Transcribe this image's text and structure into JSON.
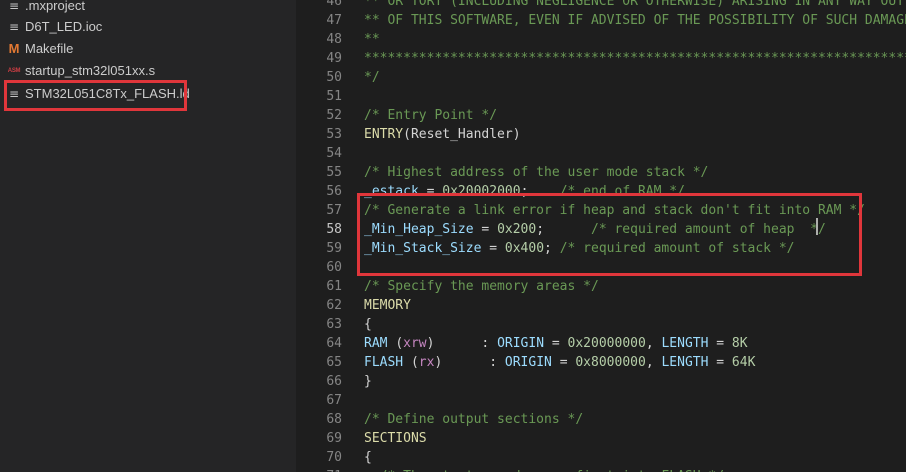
{
  "explorer": {
    "files": [
      {
        "name": ".mxproject",
        "icon": "lines-file-icon"
      },
      {
        "name": "D6T_LED.ioc",
        "icon": "lines-file-icon"
      },
      {
        "name": "Makefile",
        "icon": "makefile-icon"
      },
      {
        "name": "startup_stm32l051xx.s",
        "icon": "asm-file-icon"
      },
      {
        "name": "STM32L051C8Tx_FLASH.ld",
        "icon": "lines-file-icon"
      }
    ],
    "highlighted_file": "STM32L051C8Tx_FLASH.ld",
    "icon_glyphs": {
      "lines": "≡",
      "makefile": "M",
      "asm": "ASM"
    }
  },
  "editor": {
    "active_line": "58",
    "lines": [
      {
        "num": "46",
        "tokens": [
          {
            "t": "** OR TORT (INCLUDING NEGLIGENCE OR OTHERWISE) ARISING IN ANY WAY OUT OF THE USE",
            "c": "comment"
          }
        ]
      },
      {
        "num": "47",
        "tokens": [
          {
            "t": "** OF THIS SOFTWARE, EVEN IF ADVISED OF THE POSSIBILITY OF SUCH DAMAGE.",
            "c": "comment"
          }
        ]
      },
      {
        "num": "48",
        "tokens": [
          {
            "t": "**",
            "c": "comment"
          }
        ]
      },
      {
        "num": "49",
        "tokens": [
          {
            "t": "*****************************************************************************",
            "c": "comment"
          }
        ]
      },
      {
        "num": "50",
        "tokens": [
          {
            "t": "*/",
            "c": "comment"
          }
        ]
      },
      {
        "num": "51",
        "tokens": []
      },
      {
        "num": "52",
        "tokens": [
          {
            "t": "/* Entry Point */",
            "c": "comment"
          }
        ]
      },
      {
        "num": "53",
        "tokens": [
          {
            "t": "ENTRY",
            "c": "id"
          },
          {
            "t": "(Reset_Handler)",
            "c": "plain"
          }
        ]
      },
      {
        "num": "54",
        "tokens": []
      },
      {
        "num": "55",
        "tokens": [
          {
            "t": "/* Highest address of the user mode stack */",
            "c": "comment"
          }
        ]
      },
      {
        "num": "56",
        "tokens": [
          {
            "t": "_estack",
            "c": "var"
          },
          {
            "t": " = ",
            "c": "plain"
          },
          {
            "t": "0x20002000",
            "c": "num"
          },
          {
            "t": ";    ",
            "c": "plain"
          },
          {
            "t": "/* end of RAM */",
            "c": "comment"
          }
        ]
      },
      {
        "num": "57",
        "tokens": [
          {
            "t": "/* Generate a link error if heap and stack don't fit into RAM */",
            "c": "comment"
          }
        ]
      },
      {
        "num": "58",
        "tokens": [
          {
            "t": "_Min_Heap_Size",
            "c": "var"
          },
          {
            "t": " = ",
            "c": "plain"
          },
          {
            "t": "0x200",
            "c": "num"
          },
          {
            "t": ";      ",
            "c": "plain"
          },
          {
            "t": "/* required amount of heap  */",
            "c": "comment"
          }
        ]
      },
      {
        "num": "59",
        "tokens": [
          {
            "t": "_Min_Stack_Size",
            "c": "var"
          },
          {
            "t": " = ",
            "c": "plain"
          },
          {
            "t": "0x400",
            "c": "num"
          },
          {
            "t": "; ",
            "c": "plain"
          },
          {
            "t": "/* required amount of stack */",
            "c": "comment"
          }
        ]
      },
      {
        "num": "60",
        "tokens": []
      },
      {
        "num": "61",
        "tokens": [
          {
            "t": "/* Specify the memory areas */",
            "c": "comment"
          }
        ]
      },
      {
        "num": "62",
        "tokens": [
          {
            "t": "MEMORY",
            "c": "id"
          }
        ]
      },
      {
        "num": "63",
        "tokens": [
          {
            "t": "{",
            "c": "plain"
          }
        ]
      },
      {
        "num": "64",
        "tokens": [
          {
            "t": "RAM ",
            "c": "var"
          },
          {
            "t": "(",
            "c": "plain"
          },
          {
            "t": "xrw",
            "c": "kw"
          },
          {
            "t": ")      : ",
            "c": "plain"
          },
          {
            "t": "ORIGIN",
            "c": "var"
          },
          {
            "t": " = ",
            "c": "plain"
          },
          {
            "t": "0x20000000",
            "c": "num"
          },
          {
            "t": ", ",
            "c": "plain"
          },
          {
            "t": "LENGTH",
            "c": "var"
          },
          {
            "t": " = ",
            "c": "plain"
          },
          {
            "t": "8K",
            "c": "num"
          }
        ]
      },
      {
        "num": "65",
        "tokens": [
          {
            "t": "FLASH ",
            "c": "var"
          },
          {
            "t": "(",
            "c": "plain"
          },
          {
            "t": "rx",
            "c": "kw"
          },
          {
            "t": ")      : ",
            "c": "plain"
          },
          {
            "t": "ORIGIN",
            "c": "var"
          },
          {
            "t": " = ",
            "c": "plain"
          },
          {
            "t": "0x8000000",
            "c": "num"
          },
          {
            "t": ", ",
            "c": "plain"
          },
          {
            "t": "LENGTH",
            "c": "var"
          },
          {
            "t": " = ",
            "c": "plain"
          },
          {
            "t": "64K",
            "c": "num"
          }
        ]
      },
      {
        "num": "66",
        "tokens": [
          {
            "t": "}",
            "c": "plain"
          }
        ]
      },
      {
        "num": "67",
        "tokens": []
      },
      {
        "num": "68",
        "tokens": [
          {
            "t": "/* Define output sections */",
            "c": "comment"
          }
        ]
      },
      {
        "num": "69",
        "tokens": [
          {
            "t": "SECTIONS",
            "c": "id"
          }
        ]
      },
      {
        "num": "70",
        "tokens": [
          {
            "t": "{",
            "c": "plain"
          }
        ]
      },
      {
        "num": "71",
        "tokens": [
          {
            "t": "  /* The startup code goes first into FLASH */",
            "c": "comment"
          }
        ]
      }
    ]
  },
  "colors": {
    "highlight_border": "#e0363b",
    "comment": "#6a9955",
    "function": "#dcdcaa",
    "variable": "#9cdcfe",
    "number": "#b5cea8",
    "keyword": "#c586c0"
  }
}
